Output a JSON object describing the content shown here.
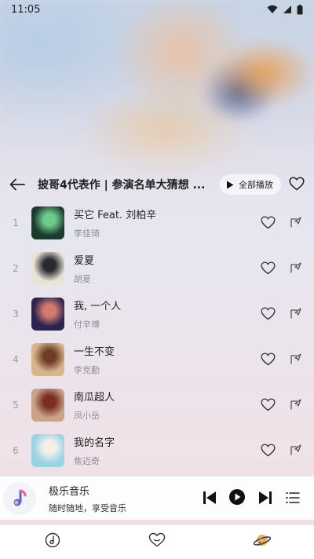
{
  "status_bar": {
    "time": "11:05",
    "icons": [
      "wifi-icon",
      "signal-icon",
      "battery-icon"
    ]
  },
  "header": {
    "title": "披哥4代表作 | 参演名单大猜想 ...",
    "play_all_label": "全部播放"
  },
  "songs": [
    {
      "index": "1",
      "title": "买它 Feat. 刘柏辛",
      "artist": "李佳琦",
      "cover_colors": [
        "#1d3a2e",
        "#6acb8a"
      ]
    },
    {
      "index": "2",
      "title": "爱夏",
      "artist": "胡夏",
      "cover_colors": [
        "#e9e2d6",
        "#2a2a30"
      ]
    },
    {
      "index": "3",
      "title": "我, 一个人",
      "artist": "付辛博",
      "cover_colors": [
        "#2b2350",
        "#d27a6e"
      ]
    },
    {
      "index": "4",
      "title": "一生不变",
      "artist": "李克勤",
      "cover_colors": [
        "#d8b48a",
        "#6e3d2a"
      ]
    },
    {
      "index": "5",
      "title": "南瓜超人",
      "artist": "凤小岳",
      "cover_colors": [
        "#c9a48a",
        "#7a2f24"
      ]
    },
    {
      "index": "6",
      "title": "我的名字",
      "artist": "焦迈奇",
      "cover_colors": [
        "#9bd3e6",
        "#f4f0e6"
      ]
    }
  ],
  "player": {
    "name": "极乐音乐",
    "subtitle": "随时随地，享受音乐"
  },
  "bottom_nav": [
    "music-disc-icon",
    "heart-icon",
    "planet-icon"
  ],
  "colors": {
    "accent": "#4a6ad8",
    "text": "#222222",
    "muted": "#8e8e98"
  }
}
